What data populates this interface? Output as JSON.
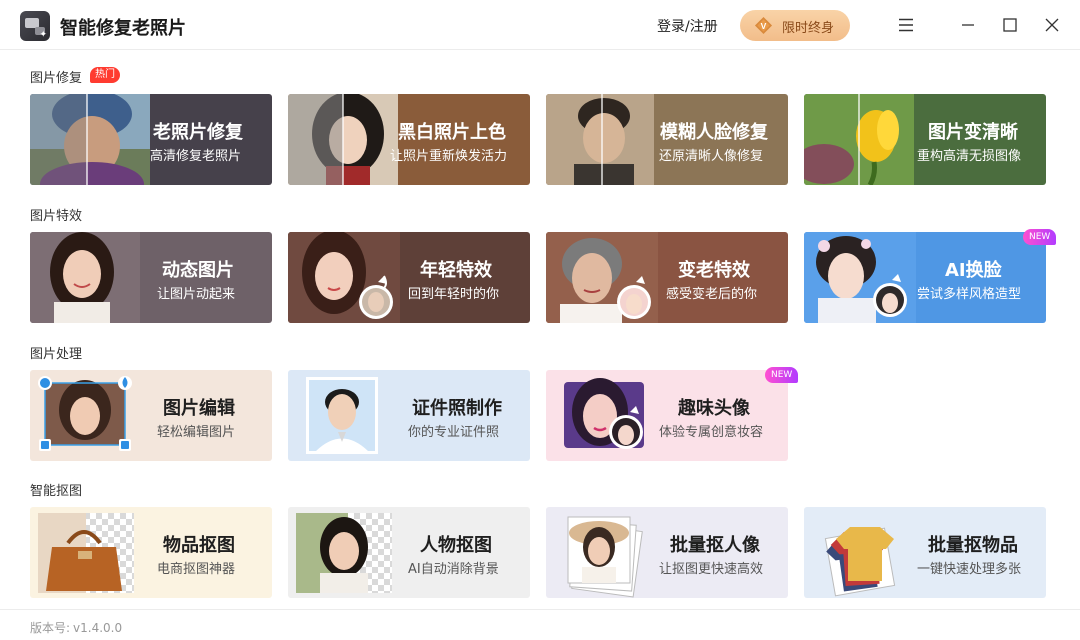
{
  "app": {
    "title": "智能修复老照片"
  },
  "header": {
    "login_label": "登录/注册",
    "vip_label": "限时终身",
    "vip_badge": "V"
  },
  "sections": [
    {
      "title": "图片修复",
      "badge": "热门",
      "cards": [
        {
          "title": "老照片修复",
          "subtitle": "高清修复老照片"
        },
        {
          "title": "黑白照片上色",
          "subtitle": "让照片重新焕发活力"
        },
        {
          "title": "模糊人脸修复",
          "subtitle": "还原清晰人像修复"
        },
        {
          "title": "图片变清晰",
          "subtitle": "重构高清无损图像"
        }
      ]
    },
    {
      "title": "图片特效",
      "cards": [
        {
          "title": "动态图片",
          "subtitle": "让图片动起来"
        },
        {
          "title": "年轻特效",
          "subtitle": "回到年轻时的你"
        },
        {
          "title": "变老特效",
          "subtitle": "感受变老后的你"
        },
        {
          "title": "AI换脸",
          "subtitle": "尝试多样风格造型",
          "badge": "NEW"
        }
      ]
    },
    {
      "title": "图片处理",
      "cards": [
        {
          "title": "图片编辑",
          "subtitle": "轻松编辑图片"
        },
        {
          "title": "证件照制作",
          "subtitle": "你的专业证件照"
        },
        {
          "title": "趣味头像",
          "subtitle": "体验专属创意妆容",
          "badge": "NEW"
        }
      ]
    },
    {
      "title": "智能抠图",
      "cards": [
        {
          "title": "物品抠图",
          "subtitle": "电商抠图神器"
        },
        {
          "title": "人物抠图",
          "subtitle": "AI自动消除背景"
        },
        {
          "title": "批量抠人像",
          "subtitle": "让抠图更快速高效"
        },
        {
          "title": "批量抠物品",
          "subtitle": "一键快速处理多张"
        }
      ]
    }
  ],
  "footer": {
    "version_label": "版本号:",
    "version_value": "v1.4.0.0"
  },
  "icons": {
    "logo": "photo-restore-logo-icon",
    "vip": "vip-diamond-icon",
    "menu": "hamburger-menu-icon",
    "minimize": "minimize-icon",
    "maximize": "maximize-icon",
    "close": "close-icon"
  },
  "colors": {
    "hot_badge": "#ff3b30",
    "vip_gradient_start": "#f9d3a7",
    "vip_gradient_end": "#f2bd8a",
    "new_badge_start": "#ff4fd0",
    "new_badge_end": "#b23cff"
  }
}
